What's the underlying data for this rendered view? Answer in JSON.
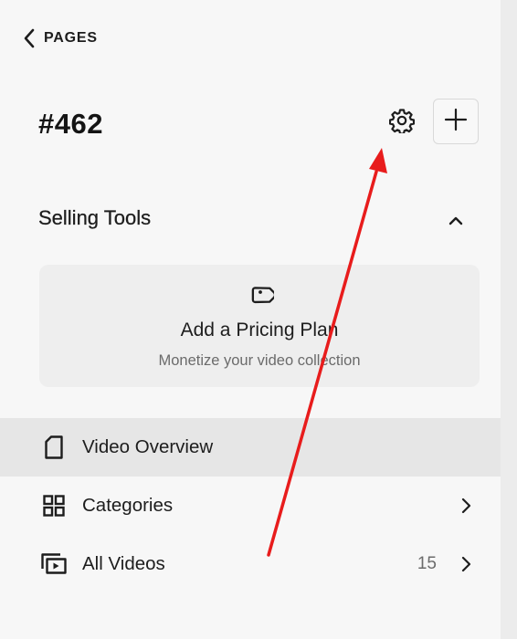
{
  "header": {
    "back_label": "PAGES",
    "back_icon": "chevron-left-icon",
    "page_title": "#462",
    "settings_icon": "gear-icon",
    "add_icon": "plus-icon"
  },
  "selling_tools": {
    "title": "Selling Tools",
    "collapse_icon": "chevron-up-icon",
    "expanded": true,
    "card": {
      "icon": "price-tag-icon",
      "title": "Add a Pricing Plan",
      "subtitle": "Monetize your video collection"
    }
  },
  "nav": {
    "items": [
      {
        "label": "Video Overview",
        "icon": "page-icon",
        "active": true
      },
      {
        "label": "Categories",
        "icon": "grid-icon",
        "has_chevron": true
      },
      {
        "label": "All Videos",
        "icon": "video-playlist-icon",
        "count": "15",
        "has_chevron": true
      }
    ]
  },
  "annotation": {
    "type": "arrow",
    "color": "#e81c1c",
    "points_to": "settings-gear-button"
  },
  "colors": {
    "background": "#f7f7f7",
    "active_row": "#e6e6e6",
    "card_background": "#eeeeee",
    "text": "#1d1d1d",
    "muted_text": "#6b6b6b",
    "annotation_red": "#e81c1c"
  }
}
